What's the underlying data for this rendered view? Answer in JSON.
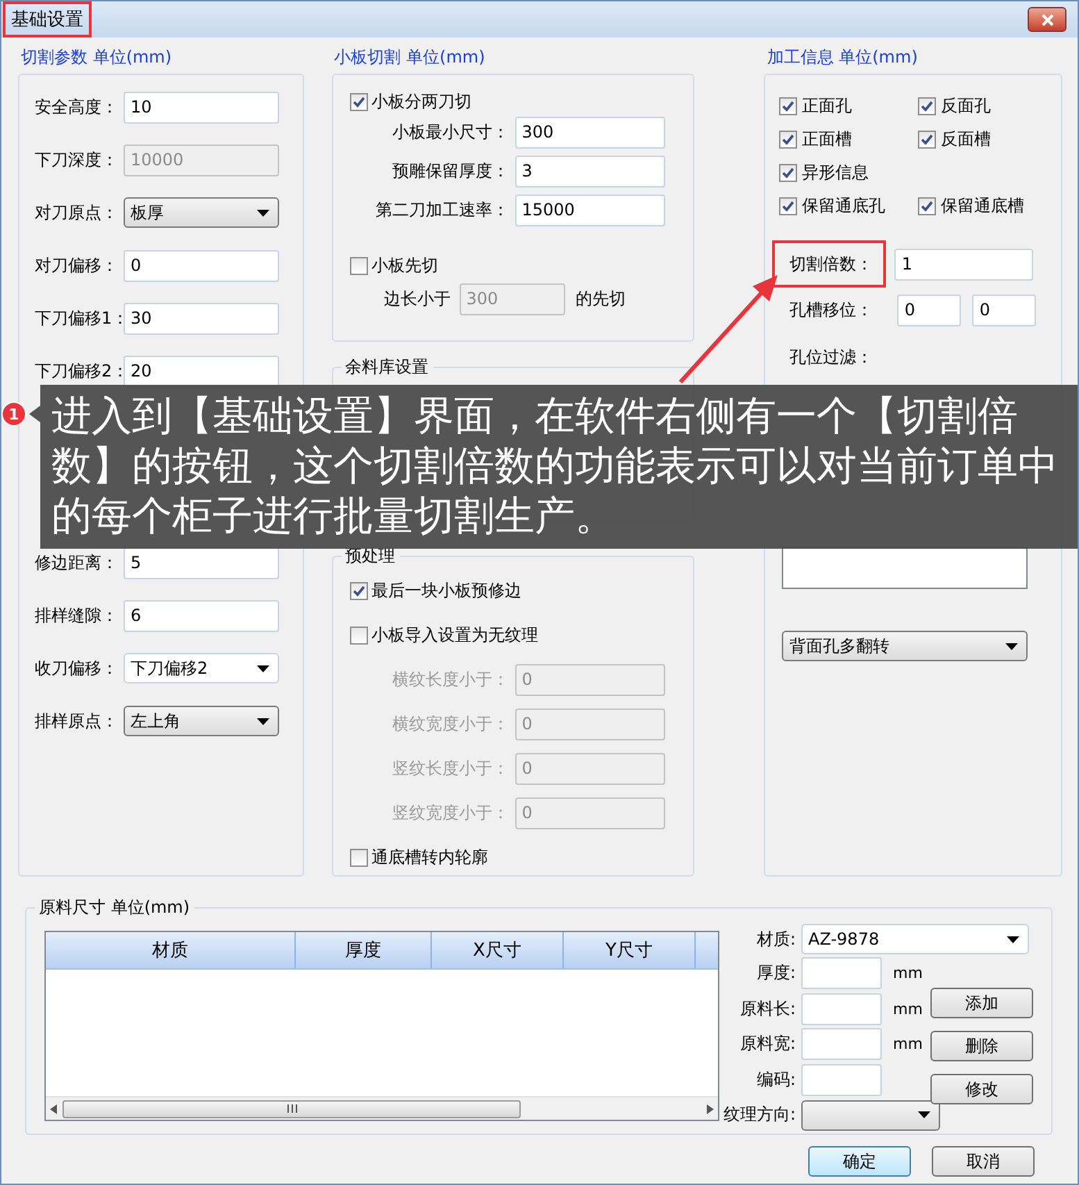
{
  "window": {
    "title": "基础设置",
    "title_highlighted": true
  },
  "cutting_params": {
    "legend": "切割参数 单位(mm)",
    "rows": [
      {
        "kind": "input",
        "label": "安全高度：",
        "value": "10"
      },
      {
        "kind": "input",
        "label": "下刀深度：",
        "value": "10000",
        "disabled": true
      },
      {
        "kind": "dropdown",
        "label": "对刀原点：",
        "value": "板厚"
      },
      {
        "kind": "input",
        "label": "对刀偏移：",
        "value": "0"
      },
      {
        "kind": "input",
        "label": "下刀偏移1：",
        "value": "30"
      },
      {
        "kind": "input",
        "label": "下刀偏移2：",
        "value": "20"
      }
    ],
    "rows_below": [
      {
        "kind": "input",
        "label": "修边距离：",
        "value": "5"
      },
      {
        "kind": "input",
        "label": "排样缝隙：",
        "value": "6"
      },
      {
        "kind": "combo",
        "label": "收刀偏移：",
        "value": "下刀偏移2"
      },
      {
        "kind": "dropdown",
        "label": "排样原点：",
        "value": "左上角"
      }
    ]
  },
  "small_board": {
    "legend": "小板切割 单位(mm)",
    "two_cut": {
      "label": "小板分两刀切",
      "checked": true
    },
    "two_cut_fields": [
      {
        "label": "小板最小尺寸：",
        "value": "300"
      },
      {
        "label": "预雕保留厚度：",
        "value": "3"
      },
      {
        "label": "第二刀加工速率：",
        "value": "15000"
      }
    ],
    "precut": {
      "label": "小板先切",
      "checked": false
    },
    "precut_field": {
      "prefix": "边长小于",
      "value": "300",
      "suffix": "的先切",
      "disabled": true
    }
  },
  "remnant": {
    "legend": "余料库设置"
  },
  "preprocess": {
    "legend": "预处理",
    "items": [
      {
        "kind": "check",
        "label": "最后一块小板预修边",
        "checked": true
      },
      {
        "kind": "check",
        "label": "小板导入设置为无纹理",
        "checked": false
      },
      {
        "kind": "input",
        "label": "横纹长度小于：",
        "value": "0",
        "disabled": true
      },
      {
        "kind": "input",
        "label": "横纹宽度小于：",
        "value": "0",
        "disabled": true
      },
      {
        "kind": "input",
        "label": "竖纹长度小于：",
        "value": "0",
        "disabled": true
      },
      {
        "kind": "input",
        "label": "竖纹宽度小于：",
        "value": "0",
        "disabled": true
      },
      {
        "kind": "check",
        "label": "通底槽转内轮廓",
        "checked": false
      }
    ]
  },
  "machining": {
    "legend": "加工信息 单位(mm)",
    "check_rows": [
      [
        {
          "label": "正面孔",
          "checked": true
        },
        {
          "label": "反面孔",
          "checked": true
        }
      ],
      [
        {
          "label": "正面槽",
          "checked": true
        },
        {
          "label": "反面槽",
          "checked": true
        }
      ],
      [
        {
          "label": "异形信息",
          "checked": true
        }
      ],
      [
        {
          "label": "保留通底孔",
          "checked": true
        },
        {
          "label": "保留通底槽",
          "checked": true
        }
      ]
    ],
    "multiplier": {
      "label": "切割倍数：",
      "value": "1",
      "highlighted": true
    },
    "offset": {
      "label": "孔槽移位：",
      "values": [
        "0",
        "0"
      ]
    },
    "filter": {
      "label": "孔位过滤："
    },
    "flip_select": {
      "value": "背面孔多翻转"
    }
  },
  "material": {
    "legend": "原料尺寸 单位(mm)",
    "table": {
      "columns": [
        "材质",
        "厚度",
        "X尺寸",
        "Y尺寸"
      ]
    },
    "form": [
      {
        "kind": "select",
        "label": "材质:",
        "value": "AZ-9878"
      },
      {
        "kind": "input",
        "label": "厚度:",
        "unit": "mm"
      },
      {
        "kind": "input",
        "label": "原料长:",
        "unit": "mm"
      },
      {
        "kind": "input",
        "label": "原料宽:",
        "unit": "mm"
      },
      {
        "kind": "input",
        "label": "编码:"
      },
      {
        "kind": "select",
        "label": "纹理方向:"
      }
    ],
    "side_buttons": [
      "添加",
      "删除",
      "修改"
    ]
  },
  "buttons": [
    {
      "label": "确定",
      "default": true
    },
    {
      "label": "取消",
      "default": false
    }
  ],
  "annotation": {
    "number": "1",
    "text": "进入到【基础设置】界面，在软件右侧有一个【切割倍数】的按钮，这个切割倍数的功能表示可以对当前订单中的每个柜子进行批量切割生产。"
  }
}
